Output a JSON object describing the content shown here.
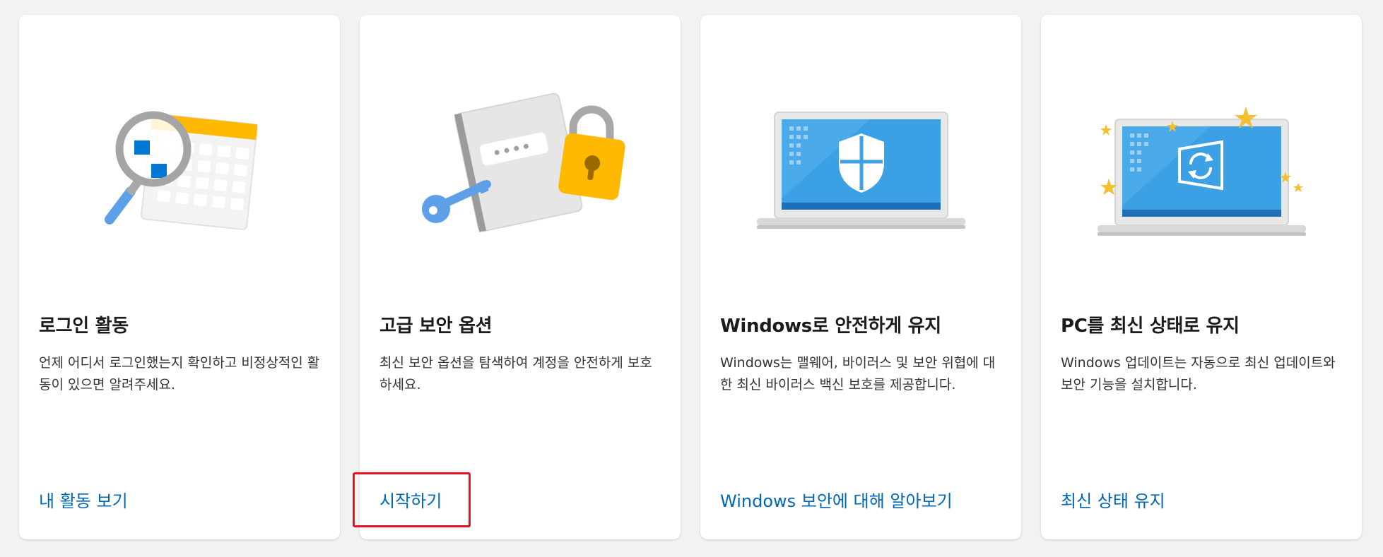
{
  "cards": [
    {
      "title": "로그인 활동",
      "description": "언제 어디서 로그인했는지 확인하고 비정상적인 활동이 있으면 알려주세요.",
      "link": "내 활동 보기",
      "illustration_icon": "calendar-magnifier-icon"
    },
    {
      "title": "고급 보안 옵션",
      "description": "최신 보안 옵션을 탐색하여 계정을 안전하게 보호하세요.",
      "link": "시작하기",
      "illustration_icon": "key-lock-icon"
    },
    {
      "title": "Windows로 안전하게 유지",
      "description": "Windows는 맬웨어, 바이러스 및 보안 위협에 대한 최신 바이러스 백신 보호를 제공합니다.",
      "link": "Windows 보안에 대해 알아보기",
      "illustration_icon": "laptop-shield-icon"
    },
    {
      "title": "PC를 최신 상태로 유지",
      "description": "Windows 업데이트는 자동으로 최신 업데이트와 보안 기능을 설치합니다.",
      "link": "최신 상태 유지",
      "illustration_icon": "laptop-update-icon"
    }
  ],
  "colors": {
    "link": "#0067b8",
    "highlight_border": "#e81123",
    "card_background": "#ffffff",
    "page_background": "#f2f2f2"
  }
}
